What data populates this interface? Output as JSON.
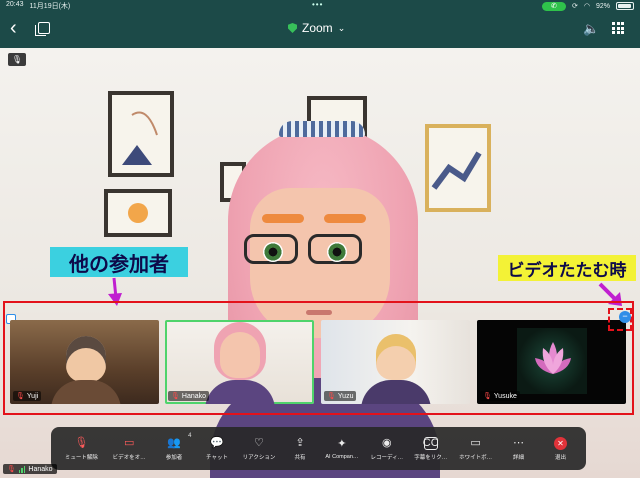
{
  "status_bar": {
    "time": "20:43",
    "date": "11月19日(木)",
    "battery": "92%"
  },
  "header": {
    "title": "Zoom",
    "dropdown_icon": "chevron-down-icon"
  },
  "annotations": {
    "participants_label": "他の参加者",
    "collapse_label": "ビデオたたむ時",
    "colors": {
      "cyan_label": "#3bd0e0",
      "yellow_label": "#f3f236",
      "outline": "#e3121b",
      "arrow": "#c020d0"
    }
  },
  "thumbnails": [
    {
      "name": "Yuji",
      "active": false
    },
    {
      "name": "Hanako",
      "active": true
    },
    {
      "name": "Yuzu",
      "active": false
    },
    {
      "name": "Yusuke",
      "active": false
    }
  ],
  "toolbar": {
    "items": [
      {
        "label": "ミュート解除",
        "icon": "mic-icon"
      },
      {
        "label": "ビデオをオ…",
        "icon": "video-icon"
      },
      {
        "label": "参加者",
        "icon": "participants-icon",
        "count": "4"
      },
      {
        "label": "チャット",
        "icon": "chat-icon"
      },
      {
        "label": "リアクション",
        "icon": "heart-icon"
      },
      {
        "label": "共有",
        "icon": "share-icon"
      },
      {
        "label": "AI Compan…",
        "icon": "sparkle-icon"
      },
      {
        "label": "レコーディ…",
        "icon": "record-icon"
      },
      {
        "label": "字幕をリク…",
        "icon": "cc-icon"
      },
      {
        "label": "ホワイトボ…",
        "icon": "whiteboard-icon"
      },
      {
        "label": "詳細",
        "icon": "more-icon"
      },
      {
        "label": "退出",
        "icon": "leave-icon"
      }
    ]
  },
  "self_view": {
    "name": "Hanako"
  }
}
